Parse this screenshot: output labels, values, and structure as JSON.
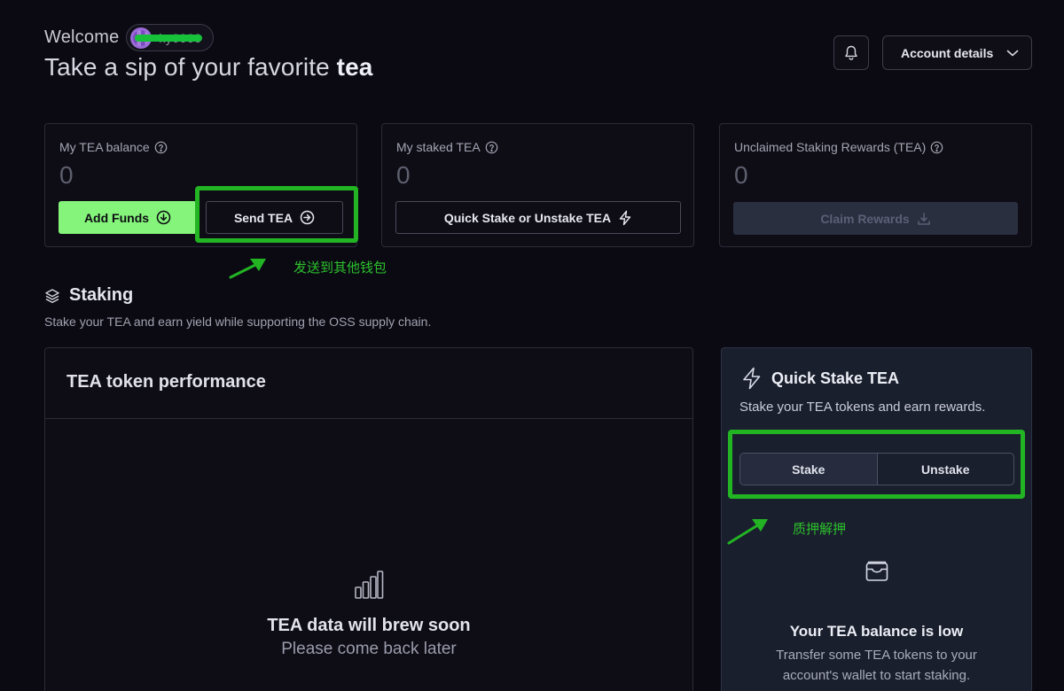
{
  "header": {
    "welcome": "Welcome",
    "username": "ky0000",
    "title_prefix": "Take a sip of your favorite ",
    "title_bold": "tea",
    "account_button": "Account details"
  },
  "cards": [
    {
      "label": "My TEA balance",
      "value": "0",
      "primary_button": "Add Funds",
      "secondary_button": "Send TEA"
    },
    {
      "label": "My staked TEA",
      "value": "0",
      "button": "Quick Stake or Unstake TEA"
    },
    {
      "label": "Unclaimed Staking Rewards (TEA)",
      "value": "0",
      "button": "Claim Rewards"
    }
  ],
  "annotations": {
    "send_note": "发送到其他钱包",
    "stake_note": "质押解押"
  },
  "staking": {
    "title": "Staking",
    "subtitle": "Stake your TEA and earn yield while supporting the OSS supply chain."
  },
  "performance": {
    "title": "TEA token performance",
    "empty_title": "TEA data will brew soon",
    "empty_sub": "Please come back later"
  },
  "quick_stake": {
    "title": "Quick Stake TEA",
    "subtitle": "Stake your TEA tokens and earn rewards.",
    "tabs": [
      "Stake",
      "Unstake"
    ],
    "empty_title": "Your TEA balance is low",
    "empty_sub": "Transfer some TEA tokens to your account's wallet to start staking."
  },
  "colors": {
    "accent_green": "#84f47a",
    "annotation_green": "#22b423",
    "background": "#0b0a13"
  }
}
